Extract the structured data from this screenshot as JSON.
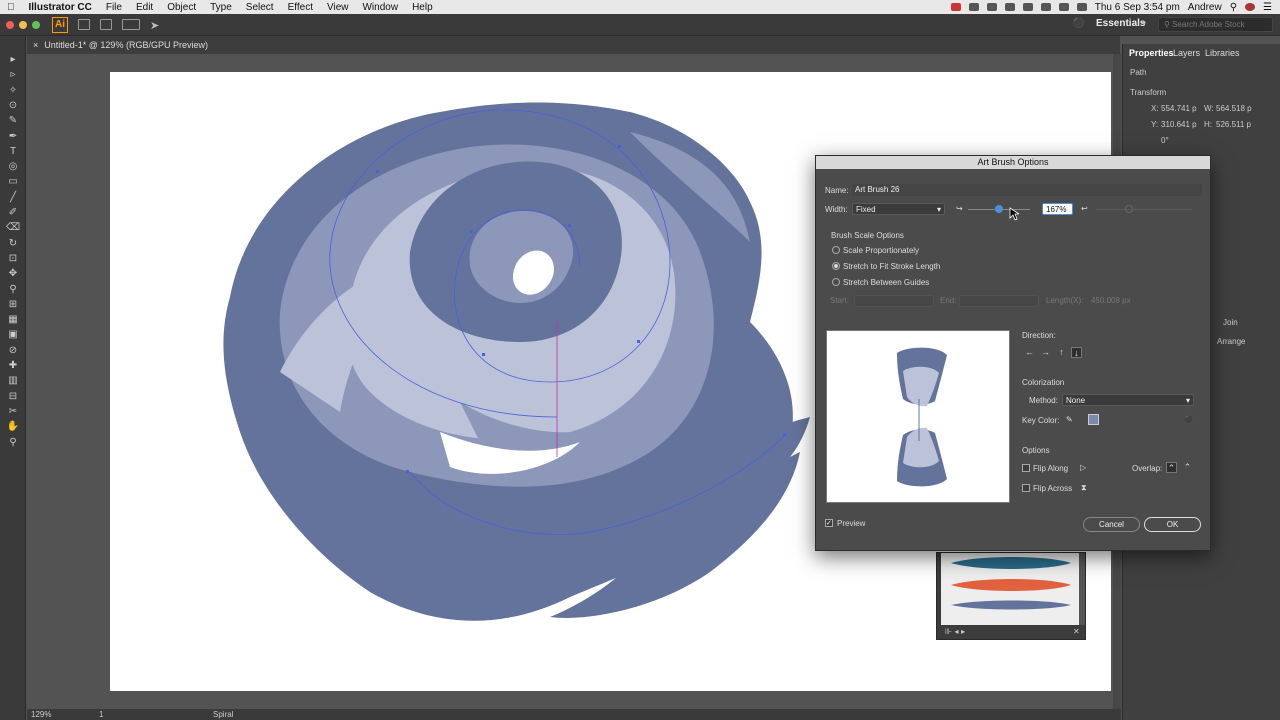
{
  "menubar": {
    "app": "Illustrator CC",
    "items": [
      "File",
      "Edit",
      "Object",
      "Type",
      "Select",
      "Effect",
      "View",
      "Window",
      "Help"
    ],
    "datetime": "Thu 6 Sep  3:54 pm",
    "user": "Andrew"
  },
  "apptoolbar": {
    "logo": "Ai",
    "workspace": "Essentials",
    "search_placeholder": "Search Adobe Stock"
  },
  "doc": {
    "tab": "Untitled-1* @ 129% (RGB/GPU Preview)"
  },
  "status": {
    "zoom": "129%",
    "artboard": "1",
    "tool": "Spiral"
  },
  "properties": {
    "tabs": [
      "Properties",
      "Layers",
      "Libraries"
    ],
    "type": "Path",
    "section": "Transform",
    "x_label": "X:",
    "x": "554.741 p",
    "y_label": "Y:",
    "y": "310.641 p",
    "w_label": "W:",
    "w": "564.518 p",
    "h_label": "H:",
    "h": "526.511 p",
    "angle": "0°",
    "join": "Join",
    "arrange": "Arrange"
  },
  "dialog": {
    "title": "Art Brush Options",
    "name_label": "Name:",
    "name": "Art Brush 26",
    "width_label": "Width:",
    "width_mode": "Fixed",
    "width_value": "167%",
    "width_slider_value": 0.5,
    "scale_header": "Brush Scale Options",
    "scale_options": [
      "Scale Proportionately",
      "Stretch to Fit Stroke Length",
      "Stretch Between Guides"
    ],
    "scale_selected": 1,
    "start_label": "Start:",
    "end_label": "End:",
    "length_label": "Length(X):",
    "length_value": "450.008 px",
    "direction_label": "Direction:",
    "direction_arrows": [
      "←",
      "→",
      "↑",
      "↓"
    ],
    "colorization_header": "Colorization",
    "method_label": "Method:",
    "method": "None",
    "keycolor_label": "Key Color:",
    "key_color": "#7c88ad",
    "options_header": "Options",
    "flip_along": "Flip Along",
    "flip_across": "Flip Across",
    "overlap_label": "Overlap:",
    "preview_label": "Preview",
    "preview_checked": true,
    "cancel": "Cancel",
    "ok": "OK"
  },
  "colors": {
    "swirl_dark": "#64739c",
    "swirl_mid": "#8d97b9",
    "swirl_light": "#bcc2d8",
    "path_blue": "#4a5fe0",
    "accent_magenta": "#c02fa8"
  }
}
